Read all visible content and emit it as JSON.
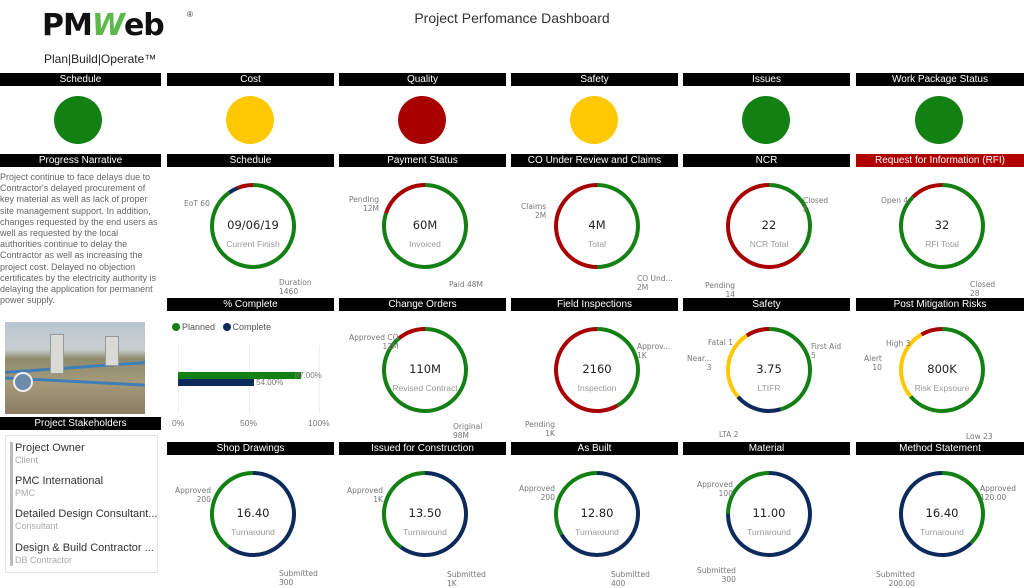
{
  "logo": {
    "brand_left": "PM",
    "brand_mid": "W",
    "brand_right": "eb",
    "registered": "®",
    "tagline": "Plan|Build|Operate™"
  },
  "title": "Project Perfomance Dashboard",
  "colors": {
    "green": "#138013",
    "yellow": "#ffc800",
    "red": "#a80000",
    "navy": "#0c2a5c",
    "header_bg": "#000000",
    "rfi_header_bg": "#b00000"
  },
  "status_lights": [
    {
      "label": "Schedule",
      "status": "green"
    },
    {
      "label": "Cost",
      "status": "yellow"
    },
    {
      "label": "Quality",
      "status": "red"
    },
    {
      "label": "Safety",
      "status": "yellow"
    },
    {
      "label": "Issues",
      "status": "green"
    },
    {
      "label": "Work Package Status",
      "status": "green"
    }
  ],
  "progress_narrative": {
    "title": "Progress Narrative",
    "text": "Project continue to face delays due to Contractor's delayed procurement of key material as well as lack of proper site management support. In addition, changes requested by the end users as well as requested by the local authorities continue to delay the Contractor as well as increasing the project cost. Delayed no objection certificates by the electricity authority is delaying the application for permanent power supply."
  },
  "stakeholders": {
    "title": "Project Stakeholders",
    "items": [
      {
        "name": "Project Owner",
        "role": "Client"
      },
      {
        "name": "PMC International",
        "role": "PMC"
      },
      {
        "name": "Detailed Design Consultant...",
        "role": "Consultant"
      },
      {
        "name": "Design & Build Contractor ...",
        "role": "DB Contractor"
      }
    ]
  },
  "percent_complete": {
    "title": "% Complete",
    "legend": [
      {
        "label": "Planned",
        "color": "green"
      },
      {
        "label": "Complete",
        "color": "navy"
      }
    ],
    "series": [
      {
        "name": "Planned",
        "value": 87,
        "label": "87.00%"
      },
      {
        "name": "Complete",
        "value": 54,
        "label": "54.00%"
      }
    ],
    "x_ticks": [
      "0%",
      "50%",
      "100%"
    ],
    "xlim": [
      0,
      100
    ]
  },
  "donuts": [
    {
      "id": "schedule",
      "title": "Schedule",
      "value": "09/06/19",
      "sub": "Current Finish",
      "segments": [
        {
          "label": "Duration",
          "val": "1460",
          "v": 1460,
          "color": "green"
        },
        {
          "label": "EoT 60",
          "val": "",
          "v": 60,
          "color": "navy"
        },
        {
          "label": "",
          "val": "",
          "v": 100,
          "color": "red"
        }
      ]
    },
    {
      "id": "payment-status",
      "title": "Payment Status",
      "value": "60M",
      "sub": "Invoiced",
      "segments": [
        {
          "label": "Paid 48M",
          "val": "",
          "v": 48,
          "color": "green"
        },
        {
          "label": "Pending",
          "val": "12M",
          "v": 12,
          "color": "red"
        }
      ]
    },
    {
      "id": "co-review",
      "title": "CO Under Review and Claims",
      "value": "4M",
      "sub": "Total",
      "segments": [
        {
          "label": "CO Und...",
          "val": "2M",
          "v": 2,
          "color": "green"
        },
        {
          "label": "Claims",
          "val": "2M",
          "v": 2,
          "color": "red"
        }
      ]
    },
    {
      "id": "ncr",
      "title": "NCR",
      "value": "22",
      "sub": "NCR Total",
      "segments": [
        {
          "label": "Closed",
          "val": "8",
          "v": 8,
          "color": "green"
        },
        {
          "label": "Pending",
          "val": "14",
          "v": 14,
          "color": "red"
        }
      ]
    },
    {
      "id": "rfi",
      "title": "Request for Information (RFI)",
      "value": "32",
      "sub": "RFI Total",
      "segments": [
        {
          "label": "Closed",
          "val": "28",
          "v": 28,
          "color": "green"
        },
        {
          "label": "Open 4",
          "val": "",
          "v": 4,
          "color": "red"
        }
      ]
    },
    {
      "id": "change-orders",
      "title": "Change Orders",
      "value": "110M",
      "sub": "Revised Contract",
      "segments": [
        {
          "label": "Original",
          "val": "98M",
          "v": 98,
          "color": "green"
        },
        {
          "label": "Approved CO",
          "val": "12M",
          "v": 12,
          "color": "red"
        }
      ]
    },
    {
      "id": "field-inspections",
      "title": "Field Inspections",
      "value": "2160",
      "sub": "Inspection",
      "segments": [
        {
          "label": "Approv...",
          "val": "1K",
          "v": 0.9,
          "color": "green"
        },
        {
          "label": "Pending",
          "val": "1K",
          "v": 1.26,
          "color": "red"
        }
      ]
    },
    {
      "id": "safety",
      "title": "Safety",
      "value": "3.75",
      "sub": "LTIFR",
      "segments": [
        {
          "label": "First Aid",
          "val": "5",
          "v": 5,
          "color": "green"
        },
        {
          "label": "LTA 2",
          "val": "",
          "v": 2,
          "color": "navy"
        },
        {
          "label": "Near...",
          "val": "3",
          "v": 3,
          "color": "yellow"
        },
        {
          "label": "Fatal 1",
          "val": "",
          "v": 1,
          "color": "red"
        }
      ]
    },
    {
      "id": "post-mitigation-risks",
      "title": "Post Mitigation Risks",
      "value": "800K",
      "sub": "Risk Expsoure",
      "segments": [
        {
          "label": "Low 23",
          "val": "",
          "v": 23,
          "color": "green"
        },
        {
          "label": "Alert",
          "val": "10",
          "v": 10,
          "color": "yellow"
        },
        {
          "label": "High 3",
          "val": "",
          "v": 3,
          "color": "red"
        }
      ]
    },
    {
      "id": "shop-drawings",
      "title": "Shop Drawings",
      "value": "16.40",
      "sub": "Turnaround",
      "segments": [
        {
          "label": "Submitted",
          "val": "300",
          "v": 300,
          "color": "navy"
        },
        {
          "label": "Approved",
          "val": "200",
          "v": 200,
          "color": "green"
        }
      ]
    },
    {
      "id": "ifc",
      "title": "Issued for Construction",
      "value": "13.50",
      "sub": "Turnaround",
      "segments": [
        {
          "label": "Submitted",
          "val": "1K",
          "v": 1.5,
          "color": "navy"
        },
        {
          "label": "Approved",
          "val": "1K",
          "v": 1.0,
          "color": "green"
        }
      ]
    },
    {
      "id": "as-built",
      "title": "As Built",
      "value": "12.80",
      "sub": "Turnaround",
      "segments": [
        {
          "label": "Submitted",
          "val": "400",
          "v": 400,
          "color": "navy"
        },
        {
          "label": "Approved",
          "val": "200",
          "v": 200,
          "color": "green"
        }
      ]
    },
    {
      "id": "material",
      "title": "Material",
      "value": "11.00",
      "sub": "Turnaround",
      "segments": [
        {
          "label": "Submitted",
          "val": "300",
          "v": 300,
          "color": "navy"
        },
        {
          "label": "Approved",
          "val": "100",
          "v": 100,
          "color": "green"
        }
      ]
    },
    {
      "id": "method-statement",
      "title": "Method Statement",
      "value": "16.40",
      "sub": "Turnaround",
      "segments": [
        {
          "label": "Approved",
          "val": "120.00",
          "v": 120,
          "color": "green"
        },
        {
          "label": "Submitted",
          "val": "200.00",
          "v": 200,
          "color": "navy"
        }
      ]
    }
  ]
}
